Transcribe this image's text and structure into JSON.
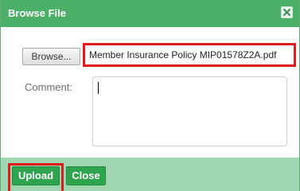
{
  "dialog": {
    "title": "Browse File",
    "close_icon": "close-x-icon"
  },
  "file": {
    "browse_label": "Browse...",
    "selected_name": "Member Insurance Policy MIP01578Z2A.pdf"
  },
  "comment": {
    "label": "Comment:",
    "value": ""
  },
  "footer": {
    "upload_label": "Upload",
    "close_label": "Close"
  },
  "colors": {
    "titlebar": "#4caf67",
    "footer": "#9fd6b1",
    "button": "#2ea44f",
    "highlight": "#e11b1b"
  }
}
